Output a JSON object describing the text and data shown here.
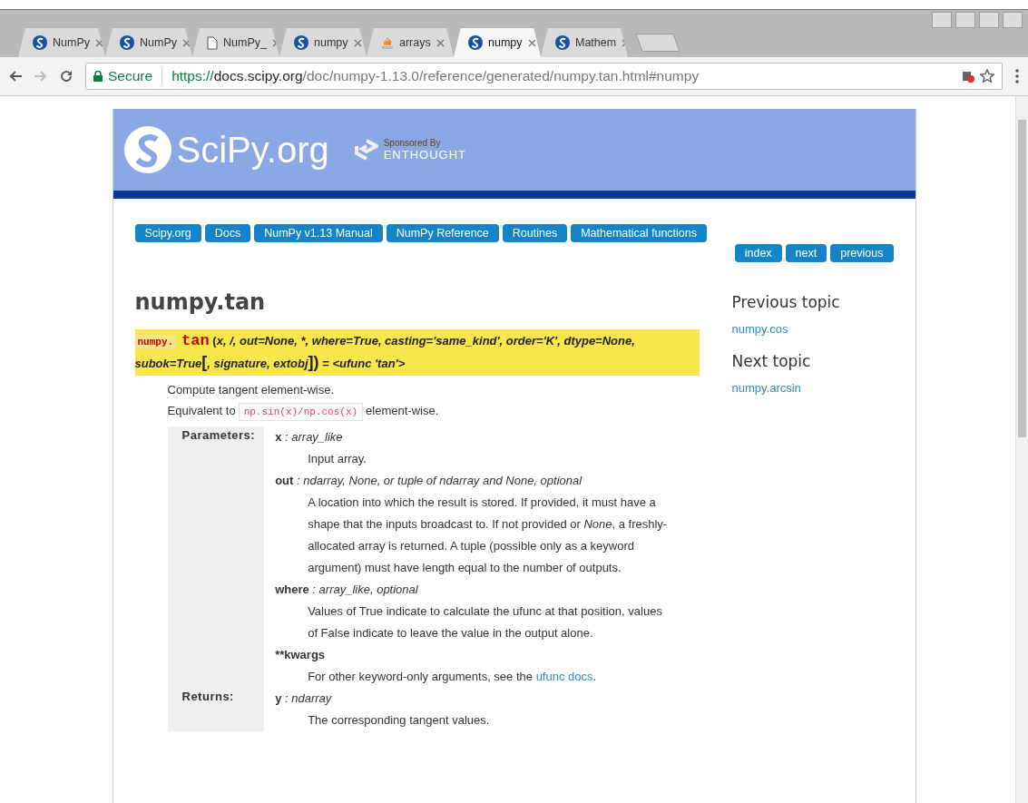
{
  "browser": {
    "tabs": [
      {
        "title": "NumPy",
        "kind": "scipy",
        "selected": false
      },
      {
        "title": "NumPy",
        "kind": "scipy",
        "selected": false
      },
      {
        "title": "NumPy_",
        "kind": "doc",
        "selected": false
      },
      {
        "title": "numpy",
        "kind": "scipy",
        "selected": false
      },
      {
        "title": "arrays",
        "kind": "stack",
        "selected": false
      },
      {
        "title": "numpy",
        "kind": "scipy",
        "selected": true
      },
      {
        "title": "Mathem",
        "kind": "scipy",
        "selected": false
      }
    ],
    "secure_label": "Secure",
    "url": {
      "scheme": "https://",
      "host": "docs.scipy.org",
      "path": "/doc/numpy-1.13.0/reference/generated/numpy.tan.html#numpy"
    }
  },
  "header": {
    "logo_text": "SciPy.org",
    "sponsored": "Sponsored By",
    "sponsor": "ENTHOUGHT"
  },
  "nav": {
    "crumbs": [
      "Scipy.org",
      "Docs",
      "NumPy v1.13 Manual",
      "NumPy Reference",
      "Routines",
      "Mathematical functions"
    ],
    "links": [
      "index",
      "next",
      "previous"
    ]
  },
  "doc": {
    "title": "numpy.tan",
    "sig_module": "numpy.",
    "sig_name": "tan",
    "sig_parts": [
      {
        "text": "(",
        "kind": "plain"
      },
      {
        "text": "x, /, out=None, *, where=True, casting='same_kind', order='K', dtype=None, subok=True",
        "kind": "italic"
      },
      {
        "text": "[",
        "kind": "bracket"
      },
      {
        "text": ", signature, extobj",
        "kind": "italic"
      },
      {
        "text": "])",
        "kind": "bracket"
      },
      {
        "text": " = ",
        "kind": "plain"
      },
      {
        "text": "<ufunc 'tan'>",
        "kind": "italic"
      }
    ],
    "summary": "Compute tangent element-wise.",
    "equiv_before": "Equivalent to",
    "equiv_code": "np.sin(x)/np.cos(x)",
    "equiv_after": "element-wise.",
    "fields": [
      {
        "label": "Parameters:",
        "items": [
          {
            "name": "x",
            "type": ": array_like",
            "desc": "Input array."
          },
          {
            "name": "out",
            "type": ": ndarray, None, or tuple of ndarray and None, optional",
            "desc": "A location into which the result is stored. If provided, it must have a shape that the inputs broadcast to. If not provided or *None*, a freshly-allocated array is returned. A tuple (possible only as a keyword argument) must have length equal to the number of outputs."
          },
          {
            "name": "where",
            "type": ": array_like, optional",
            "desc": "Values of True indicate to calculate the ufunc at that position, values of False indicate to leave the value in the output alone."
          },
          {
            "name": "**kwargs",
            "desc": "For other keyword-only arguments, see the",
            "link": "ufunc docs",
            "after": "."
          }
        ]
      },
      {
        "label": "Returns:",
        "items": [
          {
            "name": "y",
            "type": ": ndarray",
            "desc": "The corresponding tangent values."
          }
        ]
      }
    ]
  },
  "sidebar": {
    "sections": [
      {
        "heading": "Previous topic",
        "link": "numpy.cos"
      },
      {
        "heading": "Next topic",
        "link": "numpy.arcsin"
      }
    ]
  }
}
